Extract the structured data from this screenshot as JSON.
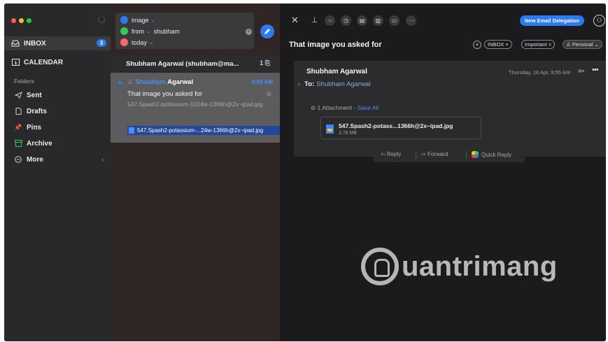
{
  "sidebar": {
    "items": [
      {
        "label": "INBOX",
        "badge": "3"
      },
      {
        "label": "CALENDAR"
      }
    ],
    "folders_label": "Folders",
    "folders": [
      {
        "label": "Sent"
      },
      {
        "label": "Drafts"
      },
      {
        "label": "Pins"
      },
      {
        "label": "Archive"
      },
      {
        "label": "More"
      }
    ]
  },
  "search": {
    "chips": [
      {
        "label": "image",
        "color": "#2d7bf4"
      },
      {
        "prefix": "from",
        "label": "shubham",
        "color": "#34c759"
      },
      {
        "label": "today",
        "color": "#ff6b6b"
      }
    ]
  },
  "thread": {
    "header": "Shubham Agarwal (shubham@ma...",
    "count": "1"
  },
  "message_row": {
    "sender_highlight": "Shubham",
    "sender_rest": "Agarwal",
    "time": "9:55 AM",
    "subject": "That image you asked for",
    "preview": "547.Spash2-potassium-1024w-1366h@2x~ipad.jpg",
    "attachment": "547.Spash2-potassium-...24w-1366h@2x~ipad.jpg"
  },
  "reader": {
    "delegation_label": "New Email Delegation",
    "subject": "That image you asked for",
    "tags": [
      "INBOX ×",
      "Important ×",
      "Personal"
    ],
    "from": "Shubham Agarwal",
    "date": "Thursday, 18 Apr, 9:55 AM",
    "to_label": "To:",
    "to_value": "Shubham Agarwal",
    "attachment_count": "1 Attachment -",
    "save_all": "Save All",
    "attachment_name": "547.Spash2-potass...1366h@2x~ipad.jpg",
    "attachment_size": "3.76 MB",
    "actions": {
      "reply": "Reply",
      "forward": "Forward",
      "quick_reply": "Quick Reply"
    }
  },
  "watermark": "uantrimang",
  "colors": {
    "accent": "#2d7bf4",
    "selected_row": "#5c5c5e",
    "attachment_highlight": "#23479a"
  }
}
